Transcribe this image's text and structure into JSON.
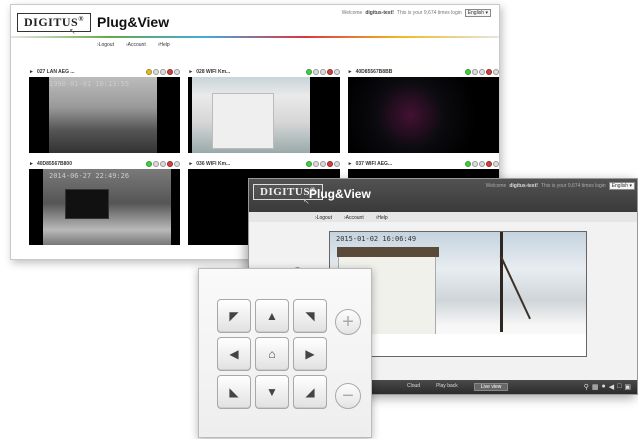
{
  "brand": {
    "logo": "DIGITUS",
    "logo_mark": "®",
    "app_name": "Plug&View"
  },
  "header": {
    "welcome_prefix": "Welcome",
    "user": "digitus-test!",
    "login_info": "This is your 9,674 times login",
    "language": "English",
    "language_arrow": "▾"
  },
  "nav": {
    "logout": "Logout",
    "account": "Account",
    "help": "Help",
    "bullet": "›"
  },
  "cameras": [
    {
      "name": "027 LAN AEG ...",
      "timestamp": "1990-01-01 10:13:55"
    },
    {
      "name": "028 WIFI Km...",
      "timestamp": ""
    },
    {
      "name": "40D85567B8BB",
      "timestamp": ""
    },
    {
      "name": "40D85567B800",
      "timestamp": "2014-06-27 22:49:26"
    },
    {
      "name": "036 WIFI Km...",
      "timestamp": ""
    },
    {
      "name": "037 WIFI AEG...",
      "timestamp": ""
    }
  ],
  "camera_arrow": "►",
  "viewer": {
    "timestamp": "2015-01-02 16:06:49",
    "tabs": {
      "cloud": "Cloud",
      "playback": "Play back",
      "live": "Live view"
    },
    "toolbar_icons": [
      "⚲",
      "▦",
      "●",
      "◀",
      "□",
      "▣"
    ]
  },
  "ptz": {
    "up_left": "◤",
    "up": "▲",
    "up_right": "◥",
    "left": "◀",
    "home": "⌂",
    "right": "▶",
    "down_left": "◣",
    "down": "▼",
    "down_right": "◢",
    "zoom_in": "+",
    "zoom_out": "−",
    "scroll_up": "⌃"
  },
  "colors": {
    "live_dot": "#44cc44",
    "record_dot": "#cc4444",
    "accent": "#3a3a3a"
  }
}
